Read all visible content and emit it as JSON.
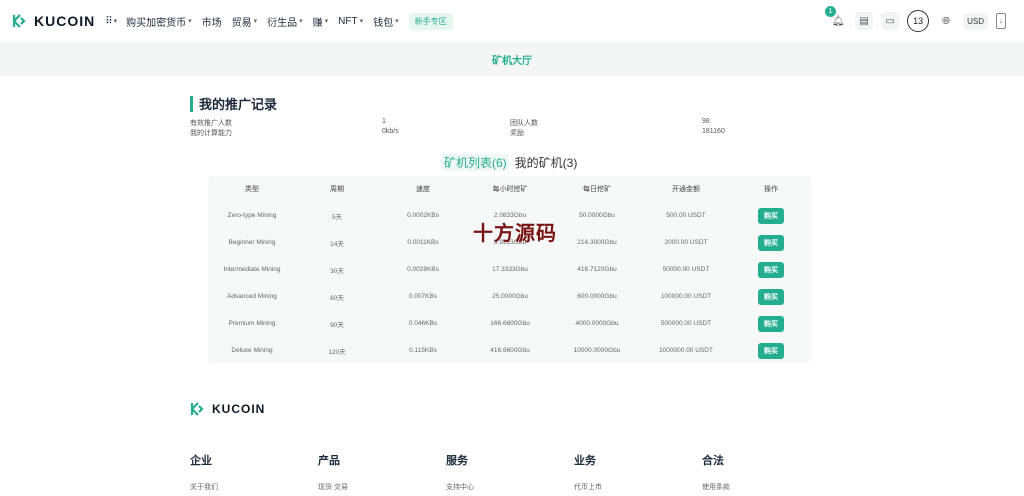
{
  "nav": {
    "logo": "KUCOIN",
    "items": [
      "购买加密货币",
      "市场",
      "贸易",
      "衍生品",
      "赚",
      "NFT",
      "钱包"
    ],
    "has_caret": [
      true,
      false,
      true,
      true,
      true,
      true,
      true
    ],
    "newbie": "新手专区",
    "notification_count": "1",
    "avatar": "13",
    "currency": "USD"
  },
  "band": {
    "title": "矿机大厅"
  },
  "referral": {
    "title": "我的推广记录",
    "rows": [
      {
        "label1": "有效推广人数",
        "value1": "1",
        "label2": "团队人数",
        "value2": "98"
      },
      {
        "label1": "我的计算能力",
        "value1": "0kb/s",
        "label2": "奖励",
        "value2": "181160"
      }
    ]
  },
  "tabs": [
    {
      "label": "矿机列表(6)",
      "active": true
    },
    {
      "label": "我的矿机(3)",
      "active": false
    }
  ],
  "table": {
    "headers": [
      "类型",
      "周期",
      "速度",
      "每小时挖矿",
      "每日挖矿",
      "开通金额",
      "操作"
    ],
    "rows": [
      [
        "Zero-type Mining",
        "5天",
        "0.0002KBs",
        "2.0833Gbu",
        "50.0000Gbu",
        "500.00 USDT"
      ],
      [
        "Beginner Mining",
        "14天",
        "0.0011KBs",
        "8.9263Gbu",
        "214.3000Gbu",
        "2000.00 USDT"
      ],
      [
        "Intermediate Mining",
        "30天",
        "0.0028KBs",
        "17.3333Gbu",
        "416.7120Gbu",
        "50000.00 USDT"
      ],
      [
        "Advanced Mining",
        "60天",
        "0.007KBs",
        "25.0000Gbu",
        "600.0000Gbu",
        "100000.00 USDT"
      ],
      [
        "Premium Mining",
        "90天",
        "0.046KBs",
        "166.6600Gbu",
        "4000.0000Gbu",
        "500000.00 USDT"
      ],
      [
        "Deluxe Mining",
        "120天",
        "0.115KBs",
        "416.6600Gbu",
        "10000.0000Gbu",
        "1000000.00 USDT"
      ]
    ],
    "buy_label": "购买"
  },
  "watermark": "十方源码",
  "footer": {
    "logo": "KUCOIN",
    "columns": [
      {
        "head": "企业",
        "link": "关于我们"
      },
      {
        "head": "产品",
        "link": "现货 交易"
      },
      {
        "head": "服务",
        "link": "支持中心"
      },
      {
        "head": "业务",
        "link": "代币上市"
      },
      {
        "head": "合法",
        "link": "使用条款"
      }
    ]
  },
  "colors": {
    "accent": "#24ae8f",
    "band_bg": "#f4f6f5",
    "table_bg": "#f7f8f8"
  }
}
